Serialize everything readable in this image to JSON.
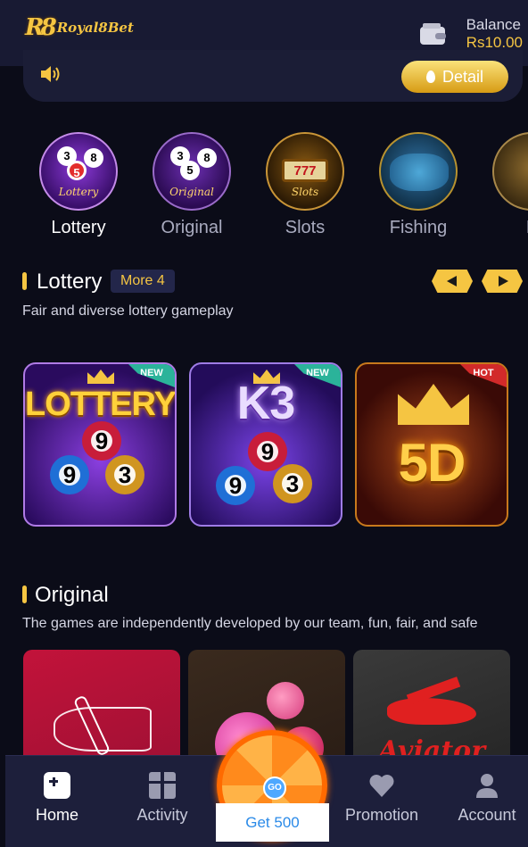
{
  "header": {
    "brand": "Royal8Bet",
    "brand_mark": "R8",
    "balance_label": "Balance",
    "balance_value": "Rs10.00"
  },
  "notice": {
    "detail_label": "Detail"
  },
  "categories": [
    {
      "label": "Lottery",
      "icon": "lottery-balls-icon",
      "caption": "Lottery"
    },
    {
      "label": "Original",
      "icon": "original-balls-icon",
      "caption": "Original"
    },
    {
      "label": "Slots",
      "icon": "slot-machine-icon",
      "caption": "Slots",
      "reels": "777"
    },
    {
      "label": "Fishing",
      "icon": "fishing-icon"
    },
    {
      "label": "F",
      "icon": "category-icon"
    }
  ],
  "lottery_section": {
    "title": "Lottery",
    "more": "More 4",
    "description": "Fair and diverse lottery gameplay",
    "cards": [
      {
        "title": "LOTTERY",
        "badge": "NEW",
        "balls": [
          "9",
          "9",
          "3"
        ]
      },
      {
        "title": "K3",
        "badge": "NEW",
        "balls": [
          "9",
          "9",
          "3"
        ]
      },
      {
        "title": "5D",
        "badge": "HOT"
      }
    ]
  },
  "original_section": {
    "title": "Original",
    "description": "The games are independently developed by our team, fun, fair, and safe",
    "cards": [
      {
        "icon": "plane-icon"
      },
      {
        "icon": "candy-icon"
      },
      {
        "icon": "aviator-plane-icon",
        "caption": "Aviator"
      }
    ]
  },
  "bottom_nav": {
    "home": "Home",
    "activity": "Activity",
    "get500": "Get 500",
    "go": "GO",
    "promotion": "Promotion",
    "account": "Account"
  },
  "colors": {
    "accent": "#f5c542",
    "background": "#0b0c18",
    "header": "#181a33",
    "nav": "#1d1f3b"
  }
}
